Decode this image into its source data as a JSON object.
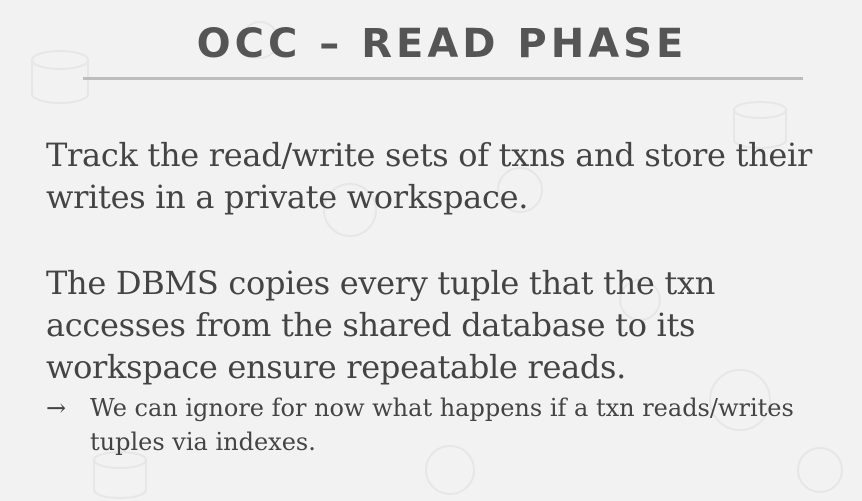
{
  "slide": {
    "title": "OCC – READ PHASE",
    "paragraphs": [
      "Track the read/write sets of txns and store their writes in a private workspace.",
      "The DBMS copies every tuple that the txn accesses from the shared database to its workspace ensure repeatable reads."
    ],
    "bullets": [
      {
        "marker": "→",
        "text": "We can ignore for now what happens if a txn reads/writes tuples via indexes."
      }
    ]
  }
}
